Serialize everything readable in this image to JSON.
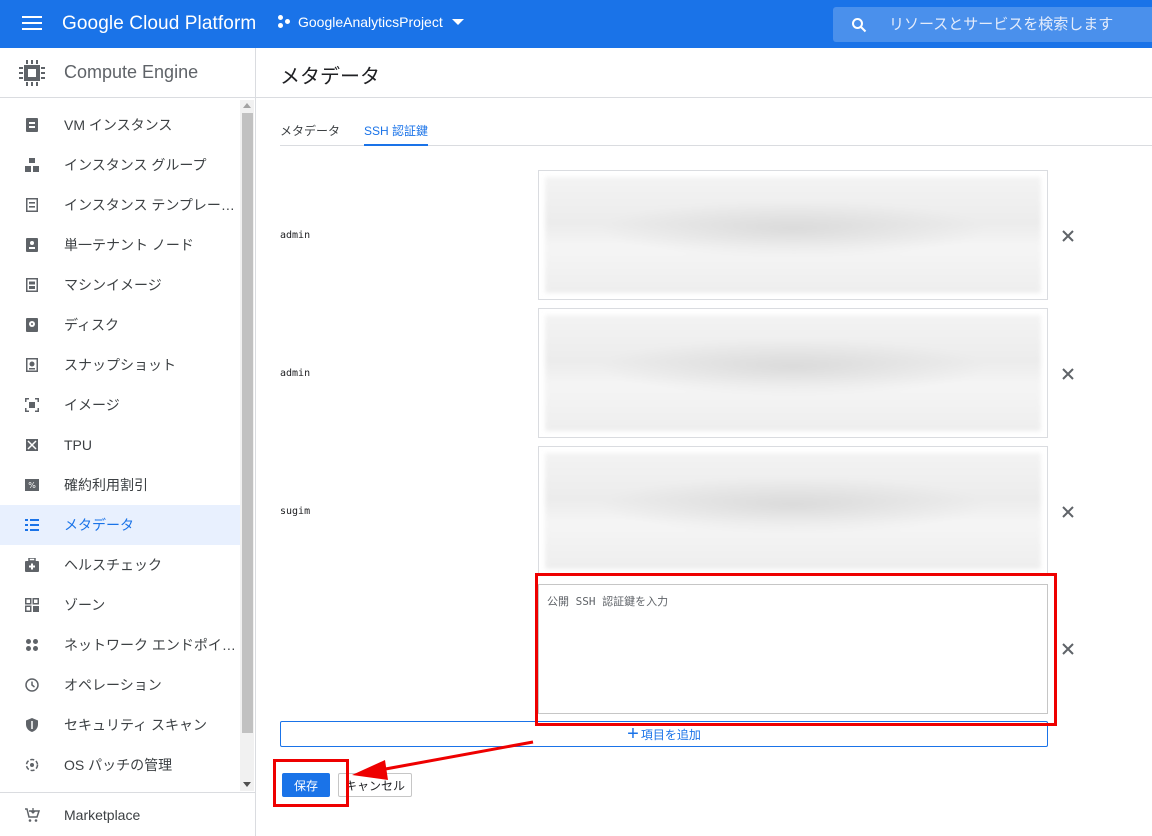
{
  "topbar": {
    "brand": "Google Cloud Platform",
    "project": "GoogleAnalyticsProject",
    "search_placeholder": "リソースとサービスを検索します"
  },
  "sidebar": {
    "product": "Compute Engine",
    "items": [
      {
        "label": "VM インスタンス",
        "icon": "vm-instance-icon"
      },
      {
        "label": "インスタンス グループ",
        "icon": "instance-group-icon"
      },
      {
        "label": "インスタンス テンプレー…",
        "icon": "instance-template-icon"
      },
      {
        "label": "単一テナント ノード",
        "icon": "sole-tenant-icon"
      },
      {
        "label": "マシンイメージ",
        "icon": "machine-image-icon"
      },
      {
        "label": "ディスク",
        "icon": "disk-icon"
      },
      {
        "label": "スナップショット",
        "icon": "snapshot-icon"
      },
      {
        "label": "イメージ",
        "icon": "image-icon"
      },
      {
        "label": "TPU",
        "icon": "tpu-icon"
      },
      {
        "label": "確約利用割引",
        "icon": "discount-icon"
      },
      {
        "label": "メタデータ",
        "icon": "metadata-icon",
        "active": true
      },
      {
        "label": "ヘルスチェック",
        "icon": "health-check-icon"
      },
      {
        "label": "ゾーン",
        "icon": "zone-icon"
      },
      {
        "label": "ネットワーク エンドポイ…",
        "icon": "network-endpoint-icon"
      },
      {
        "label": "オペレーション",
        "icon": "operations-icon"
      },
      {
        "label": "セキュリティ スキャン",
        "icon": "security-scan-icon"
      },
      {
        "label": "OS パッチの管理",
        "icon": "os-patch-icon"
      }
    ],
    "marketplace": "Marketplace"
  },
  "main": {
    "title": "メタデータ",
    "tabs": [
      "メタデータ",
      "SSH 認証鍵"
    ],
    "active_tab": 1,
    "keys": [
      {
        "user": "admin"
      },
      {
        "user": "admin"
      },
      {
        "user": "sugim"
      }
    ],
    "new_key_placeholder": "公開 SSH 認証鍵を入力",
    "add_item": "項目を追加",
    "save": "保存",
    "cancel": "キャンセル"
  },
  "colors": {
    "header": "#1a73e8",
    "accent": "#1a73e8",
    "annotation": "#e00000"
  }
}
